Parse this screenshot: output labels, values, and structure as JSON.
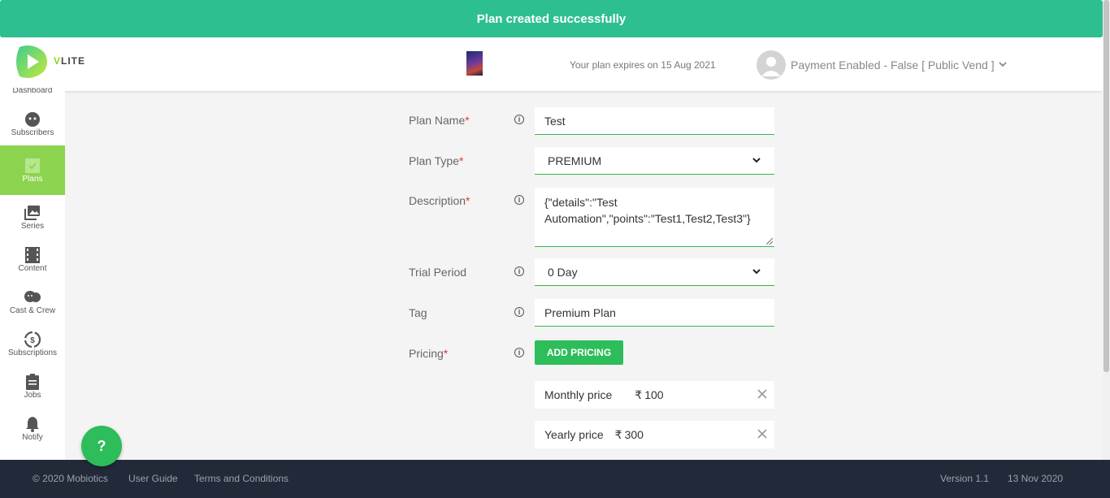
{
  "toast": {
    "message": "Plan created successfully"
  },
  "header": {
    "logo_letter": "V",
    "logo_rest": "LITE",
    "expiry_text": "Your plan expires on 15 Aug 2021",
    "account_text": "Payment Enabled - False [ Public Vend ]"
  },
  "sidebar": {
    "items": [
      {
        "label": "Dashboard",
        "icon": "dashboard-icon"
      },
      {
        "label": "Subscribers",
        "icon": "face-icon"
      },
      {
        "label": "Plans",
        "icon": "checkbox-icon",
        "active": true
      },
      {
        "label": "Series",
        "icon": "photo-library-icon"
      },
      {
        "label": "Content",
        "icon": "film-icon"
      },
      {
        "label": "Cast & Crew",
        "icon": "theater-masks-icon"
      },
      {
        "label": "Subscriptions",
        "icon": "dollar-cycle-icon"
      },
      {
        "label": "Jobs",
        "icon": "clipboard-icon"
      },
      {
        "label": "Notify",
        "icon": "bell-icon"
      }
    ]
  },
  "form": {
    "plan_name": {
      "label": "Plan Name",
      "required": "*",
      "value": "Test"
    },
    "plan_type": {
      "label": "Plan Type",
      "required": "*",
      "value": "PREMIUM"
    },
    "description": {
      "label": "Description",
      "required": "*",
      "value": "{\"details\":\"Test Automation\",\"points\":\"Test1,Test2,Test3\"}"
    },
    "trial_period": {
      "label": "Trial Period",
      "value": "0 Day"
    },
    "tag": {
      "label": "Tag",
      "value": "Premium Plan"
    },
    "pricing": {
      "label": "Pricing",
      "required": "*",
      "add_button": "ADD PRICING",
      "items": [
        {
          "label": "Monthly price",
          "currency": "₹",
          "amount": "100"
        },
        {
          "label": "Yearly price",
          "currency": "₹",
          "amount": "300"
        }
      ]
    },
    "info_glyph": "i"
  },
  "help_button": {
    "label": "?"
  },
  "footer": {
    "copyright": "© 2020 Mobiotics",
    "user_guide": "User Guide",
    "terms": "Terms and Conditions",
    "version": "Version 1.1",
    "date": "13 Nov 2020"
  },
  "colors": {
    "toast_bg": "#2ebf91",
    "accent_green": "#2dbd5a",
    "sidebar_active": "#8cd44f",
    "footer_bg": "#222a3a"
  }
}
